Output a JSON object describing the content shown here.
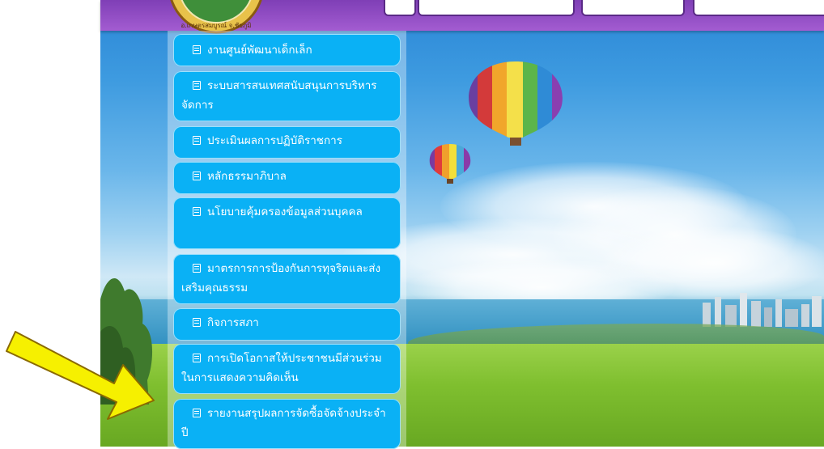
{
  "menu": {
    "items": [
      {
        "label": "งานศูนย์พัฒนาเด็กเล็ก"
      },
      {
        "label": "ระบบสารสนเทศสนับสนุนการบริหารจัดการ"
      },
      {
        "label": "ประเมินผลการปฏิบัติราชการ"
      },
      {
        "label": "หลักธรรมาภิบาล"
      },
      {
        "label": "นโยบายคุ้มครองข้อมูลส่วนบุคคล"
      },
      {
        "label": "มาตรการการป้องกันการทุจริตและส่งเสริมคุณธรรม"
      },
      {
        "label": "กิจการสภา"
      },
      {
        "label": "การเปิดโอกาสให้ประชาชนมีส่วนร่วมในการแสดงความคิดเห็น"
      },
      {
        "label": "รายงานสรุปผลการจัดซื้อจัดจ้างประจำปี"
      }
    ]
  },
  "seal": {
    "text": "อ.เกษตรสมบูรณ์ จ.ชัยภูมิ"
  },
  "colors": {
    "menu_bg": "#0ab1f5",
    "topbar": "#8a47c0",
    "arrow_fill": "#f6f000",
    "arrow_stroke": "#8a6a00"
  },
  "icons": {
    "menu_item": "document-icon",
    "annotation": "arrow-pointer"
  }
}
